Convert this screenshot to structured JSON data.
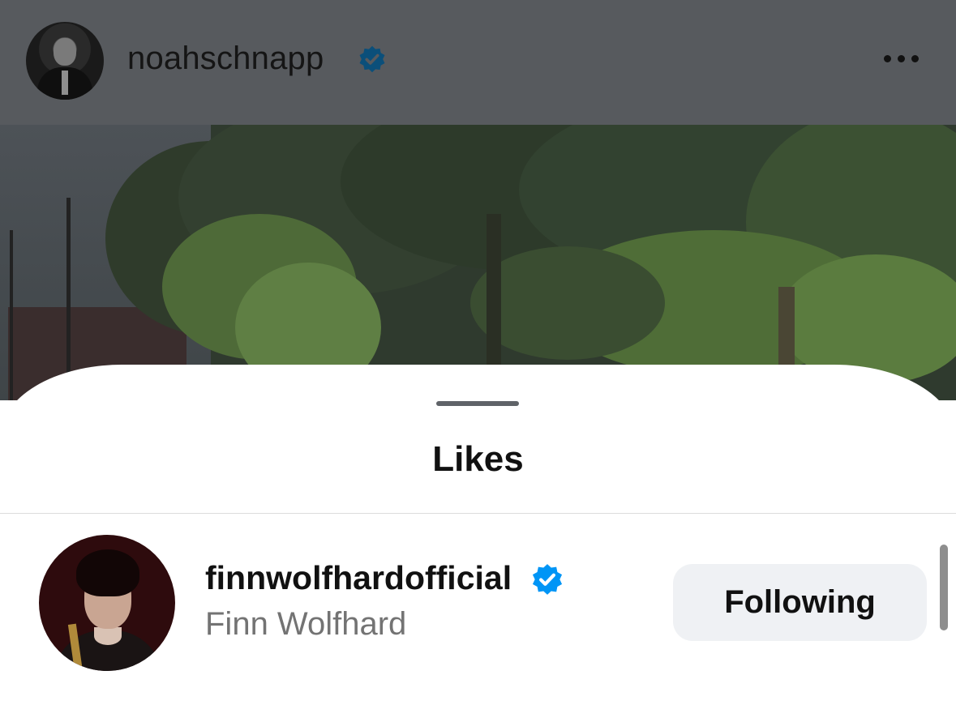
{
  "post": {
    "username": "noahschnapp",
    "verified_icon": "verified-badge-icon",
    "more_icon": "more-horizontal-icon"
  },
  "sheet": {
    "title": "Likes"
  },
  "likes": [
    {
      "username": "finnwolfhardofficial",
      "full_name": "Finn Wolfhard",
      "verified": true,
      "button_label": "Following"
    }
  ],
  "colors": {
    "verified_blue": "#0095f6",
    "verified_blue_dimmed": "#0b4f7a",
    "button_bg": "#eff1f4",
    "secondary_text": "#737373"
  }
}
